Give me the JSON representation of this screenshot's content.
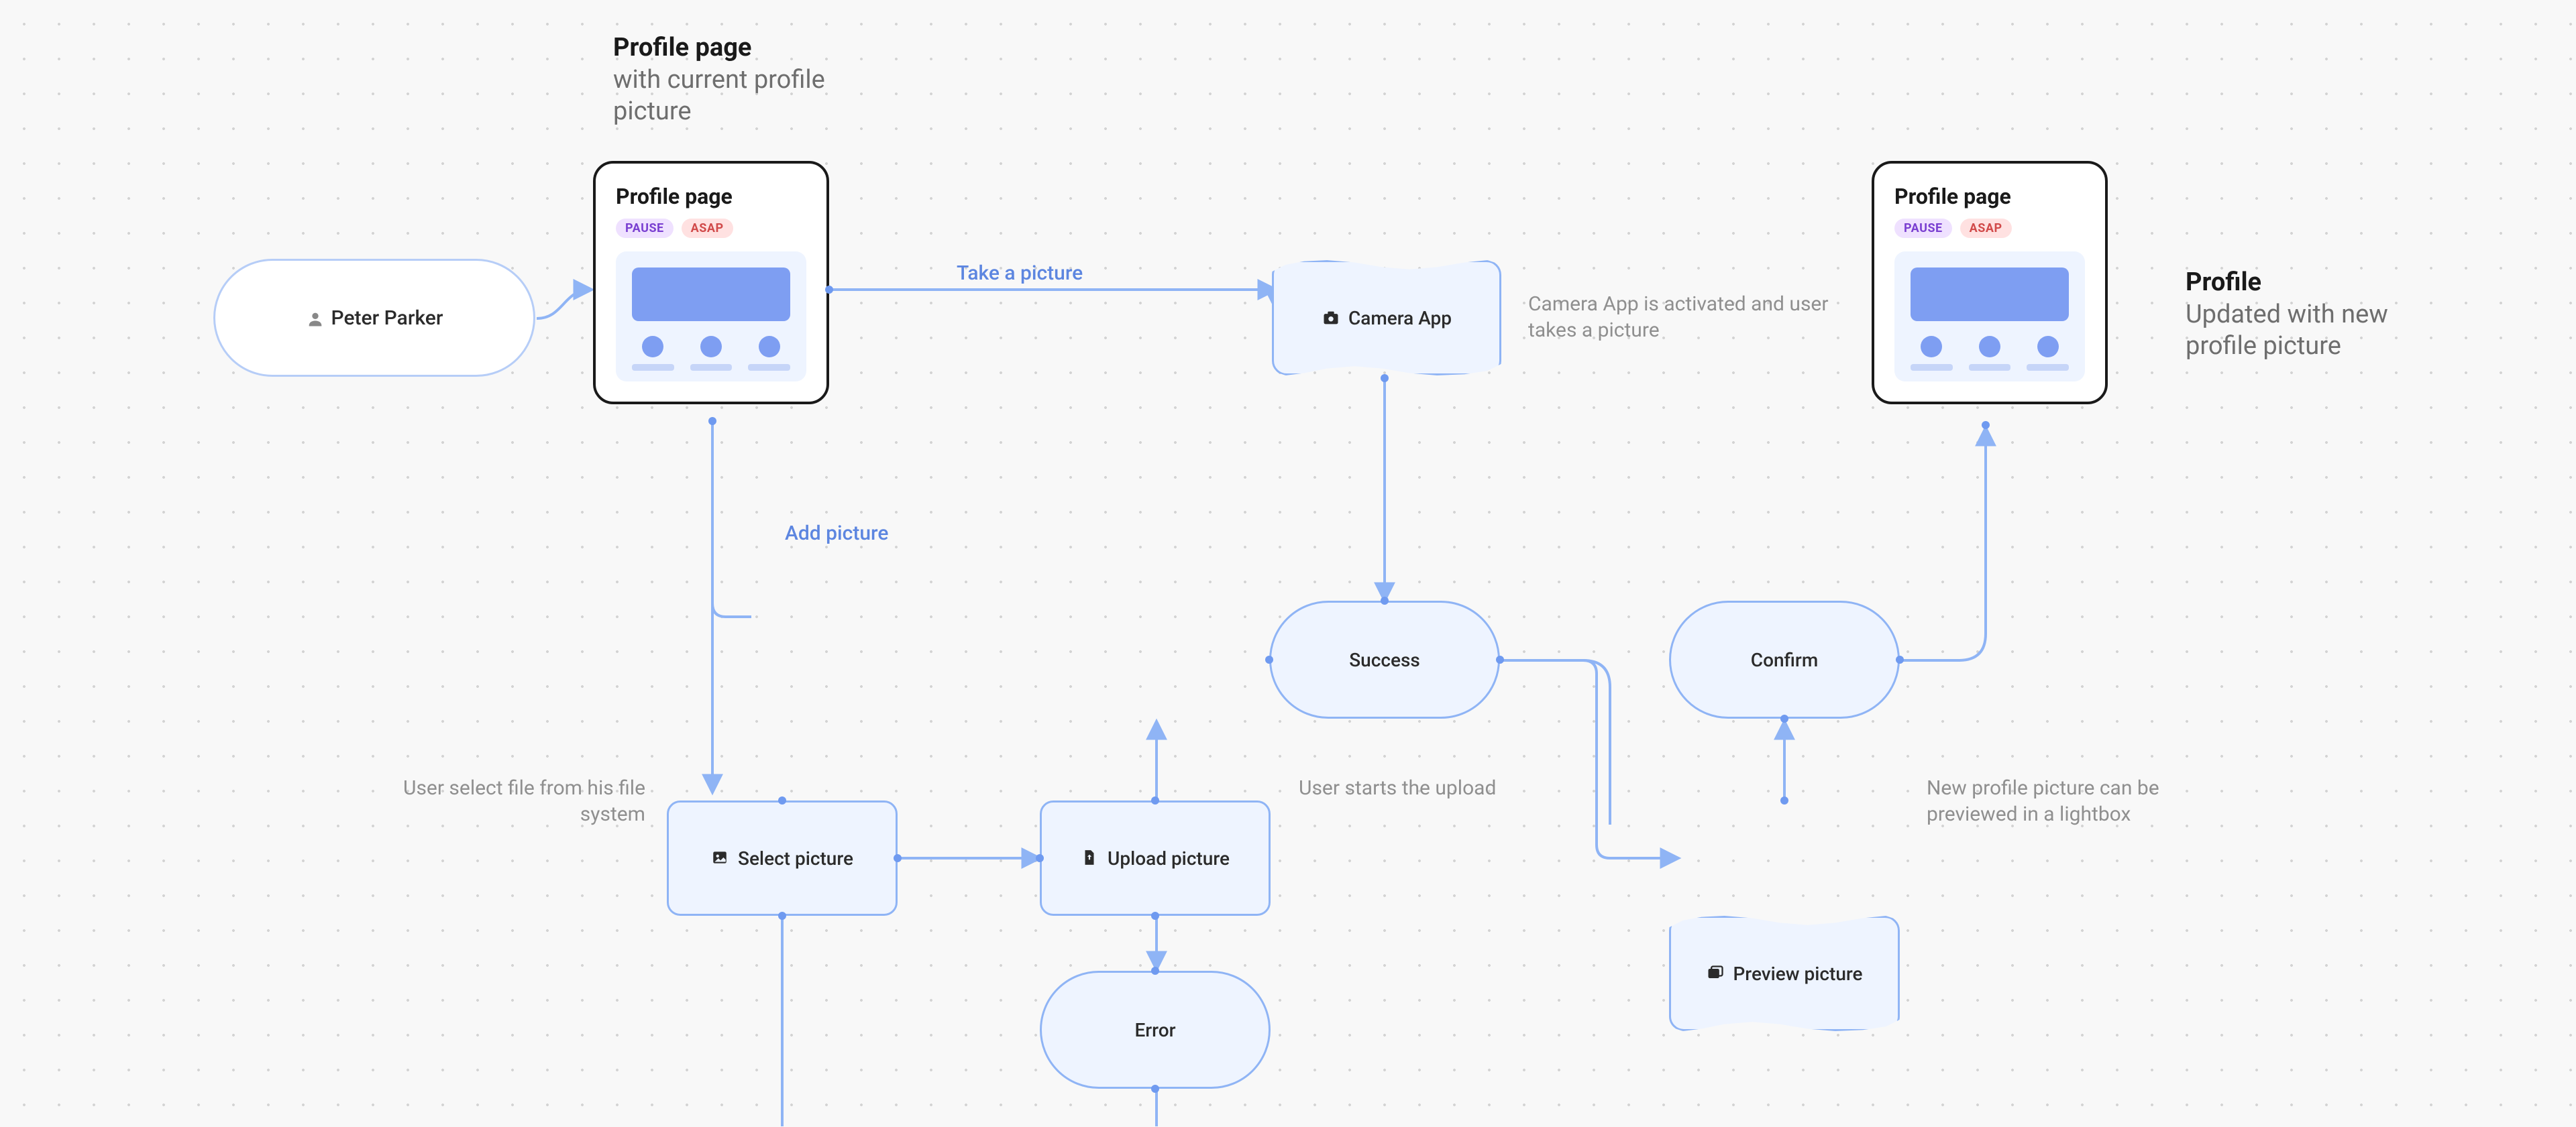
{
  "titles": {
    "profile_page": {
      "strong": "Profile page",
      "sub": "with current profile picture"
    },
    "profile_updated": {
      "strong": "Profile",
      "sub": "Updated with new profile picture"
    }
  },
  "nodes": {
    "start": {
      "label": "Peter Parker"
    },
    "camera_app": {
      "label": "Camera App"
    },
    "select_picture": {
      "label": "Select picture"
    },
    "upload_picture": {
      "label": "Upload picture"
    },
    "preview_picture": {
      "label": "Preview picture"
    },
    "success": {
      "label": "Success"
    },
    "error": {
      "label": "Error"
    },
    "confirm": {
      "label": "Confirm"
    }
  },
  "card": {
    "title": "Profile page",
    "badges": {
      "pause": "PAUSE",
      "asap": "ASAP"
    }
  },
  "edges": {
    "take_picture": "Take a picture",
    "add_picture": "Add picture"
  },
  "annotations": {
    "camera_activated": "Camera App is activated and user takes a picture",
    "user_select_file": "User select file from his file system",
    "user_starts_upload": "User starts the upload",
    "preview_lightbox": "New profile picture can be previewed in a lightbox"
  }
}
